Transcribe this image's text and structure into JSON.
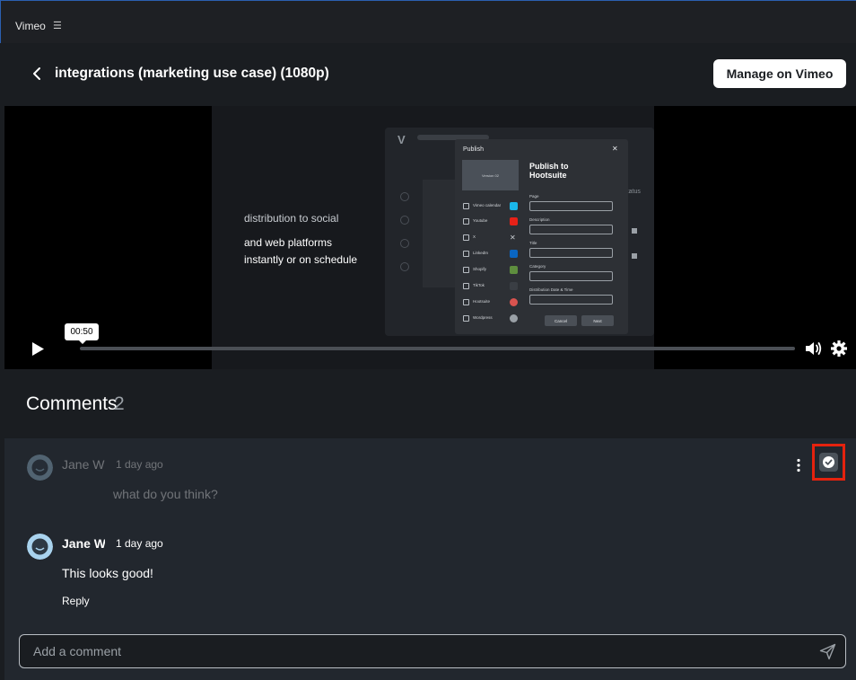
{
  "titlebar": {
    "app_name": "Vimeo",
    "menu_icon": "hamburger-menu-icon"
  },
  "header": {
    "back_icon": "chevron-left-icon",
    "video_title": "integrations (marketing use case) (1080p)",
    "manage_label": "Manage on Vimeo"
  },
  "player": {
    "frame_text_line1": "distribution to social",
    "frame_text_line2": "and web platforms",
    "frame_text_line3": "instantly or on schedule",
    "dialog": {
      "title": "Publish",
      "thumb_label": "Version 02",
      "heading": "Publish to Hootsuite",
      "options": [
        "Vimeo calendar",
        "Youtube",
        "X",
        "LinkedIn",
        "Shopify",
        "TikTok",
        "Hootsuite",
        "Wordpress"
      ],
      "fields": [
        "Page",
        "Description",
        "Title",
        "Category",
        "Distribution Date & Time"
      ],
      "cancel": "Cancel",
      "next": "Next"
    },
    "status_text": "Status",
    "time_tooltip": "00:50",
    "progress_fraction": 0.0
  },
  "comments": {
    "label": "Comments",
    "count": "2",
    "items": [
      {
        "author": "Jane Wu",
        "time": "1 day ago",
        "text": "what do you think?",
        "resolved": true
      },
      {
        "author": "Jane Wu",
        "time": "1 day ago",
        "text": "This looks good!",
        "reply_label": "Reply"
      }
    ]
  },
  "composer": {
    "placeholder": "Add a comment",
    "send_icon": "send-icon"
  },
  "colors": {
    "highlight": "#e5220e",
    "avatar": "#a9d3ee",
    "background": "#1a1d21"
  }
}
